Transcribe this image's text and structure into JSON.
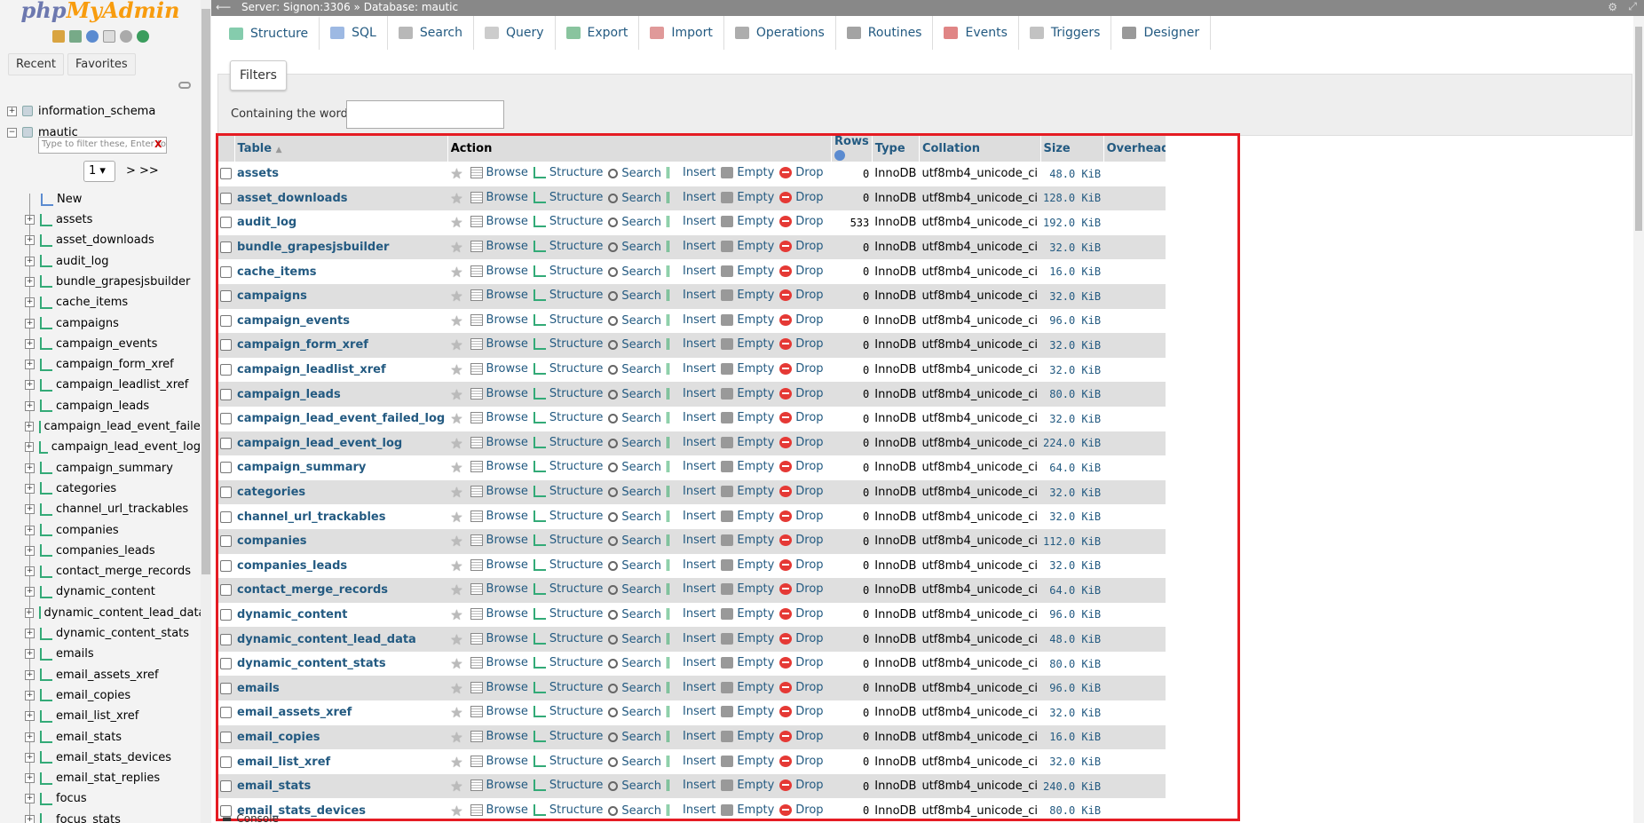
{
  "nav": {
    "logo_php": "php",
    "logo_myadmin": "MyAdmin",
    "tabs": [
      "Recent",
      "Favorites"
    ],
    "databases": [
      "information_schema",
      "mautic"
    ],
    "filter_placeholder": "Type to filter these, Enter to search",
    "filter_clear": "X",
    "page_value": "1",
    "page_next": "> >>",
    "new_label": "New",
    "tables": [
      "assets",
      "asset_downloads",
      "audit_log",
      "bundle_grapesjsbuilder",
      "cache_items",
      "campaigns",
      "campaign_events",
      "campaign_form_xref",
      "campaign_leadlist_xref",
      "campaign_leads",
      "campaign_lead_event_failed_log",
      "campaign_lead_event_log",
      "campaign_summary",
      "categories",
      "channel_url_trackables",
      "companies",
      "companies_leads",
      "contact_merge_records",
      "dynamic_content",
      "dynamic_content_lead_data",
      "dynamic_content_stats",
      "emails",
      "email_assets_xref",
      "email_copies",
      "email_list_xref",
      "email_stats",
      "email_stats_devices",
      "email_stat_replies",
      "focus",
      "focus_stats"
    ]
  },
  "topbar": {
    "server": "Server: Signon:3306",
    "sep": "»",
    "database": "Database: mautic"
  },
  "tabs": [
    "Structure",
    "SQL",
    "Search",
    "Query",
    "Export",
    "Import",
    "Operations",
    "Routines",
    "Events",
    "Triggers",
    "Designer"
  ],
  "filters": {
    "legend": "Filters",
    "label": "Containing the word:"
  },
  "table": {
    "headers": {
      "table": "Table",
      "action": "Action",
      "rows": "Rows",
      "type": "Type",
      "collation": "Collation",
      "size": "Size",
      "overhead": "Overhead"
    },
    "actions": [
      "Browse",
      "Structure",
      "Search",
      "Insert",
      "Empty",
      "Drop"
    ],
    "rows": [
      {
        "name": "assets",
        "rows": "0",
        "type": "InnoDB",
        "collation": "utf8mb4_unicode_ci",
        "size": "48.0 KiB",
        "overhead": "-"
      },
      {
        "name": "asset_downloads",
        "rows": "0",
        "type": "InnoDB",
        "collation": "utf8mb4_unicode_ci",
        "size": "128.0 KiB",
        "overhead": "-"
      },
      {
        "name": "audit_log",
        "rows": "533",
        "type": "InnoDB",
        "collation": "utf8mb4_unicode_ci",
        "size": "192.0 KiB",
        "overhead": "-"
      },
      {
        "name": "bundle_grapesjsbuilder",
        "rows": "0",
        "type": "InnoDB",
        "collation": "utf8mb4_unicode_ci",
        "size": "32.0 KiB",
        "overhead": "-"
      },
      {
        "name": "cache_items",
        "rows": "0",
        "type": "InnoDB",
        "collation": "utf8mb4_unicode_ci",
        "size": "16.0 KiB",
        "overhead": "-"
      },
      {
        "name": "campaigns",
        "rows": "0",
        "type": "InnoDB",
        "collation": "utf8mb4_unicode_ci",
        "size": "32.0 KiB",
        "overhead": "-"
      },
      {
        "name": "campaign_events",
        "rows": "0",
        "type": "InnoDB",
        "collation": "utf8mb4_unicode_ci",
        "size": "96.0 KiB",
        "overhead": "-"
      },
      {
        "name": "campaign_form_xref",
        "rows": "0",
        "type": "InnoDB",
        "collation": "utf8mb4_unicode_ci",
        "size": "32.0 KiB",
        "overhead": "-"
      },
      {
        "name": "campaign_leadlist_xref",
        "rows": "0",
        "type": "InnoDB",
        "collation": "utf8mb4_unicode_ci",
        "size": "32.0 KiB",
        "overhead": "-"
      },
      {
        "name": "campaign_leads",
        "rows": "0",
        "type": "InnoDB",
        "collation": "utf8mb4_unicode_ci",
        "size": "80.0 KiB",
        "overhead": "-"
      },
      {
        "name": "campaign_lead_event_failed_log",
        "rows": "0",
        "type": "InnoDB",
        "collation": "utf8mb4_unicode_ci",
        "size": "32.0 KiB",
        "overhead": "-"
      },
      {
        "name": "campaign_lead_event_log",
        "rows": "0",
        "type": "InnoDB",
        "collation": "utf8mb4_unicode_ci",
        "size": "224.0 KiB",
        "overhead": "-"
      },
      {
        "name": "campaign_summary",
        "rows": "0",
        "type": "InnoDB",
        "collation": "utf8mb4_unicode_ci",
        "size": "64.0 KiB",
        "overhead": "-"
      },
      {
        "name": "categories",
        "rows": "0",
        "type": "InnoDB",
        "collation": "utf8mb4_unicode_ci",
        "size": "32.0 KiB",
        "overhead": "-"
      },
      {
        "name": "channel_url_trackables",
        "rows": "0",
        "type": "InnoDB",
        "collation": "utf8mb4_unicode_ci",
        "size": "32.0 KiB",
        "overhead": "-"
      },
      {
        "name": "companies",
        "rows": "0",
        "type": "InnoDB",
        "collation": "utf8mb4_unicode_ci",
        "size": "112.0 KiB",
        "overhead": "-"
      },
      {
        "name": "companies_leads",
        "rows": "0",
        "type": "InnoDB",
        "collation": "utf8mb4_unicode_ci",
        "size": "32.0 KiB",
        "overhead": "-"
      },
      {
        "name": "contact_merge_records",
        "rows": "0",
        "type": "InnoDB",
        "collation": "utf8mb4_unicode_ci",
        "size": "64.0 KiB",
        "overhead": "-"
      },
      {
        "name": "dynamic_content",
        "rows": "0",
        "type": "InnoDB",
        "collation": "utf8mb4_unicode_ci",
        "size": "96.0 KiB",
        "overhead": "-"
      },
      {
        "name": "dynamic_content_lead_data",
        "rows": "0",
        "type": "InnoDB",
        "collation": "utf8mb4_unicode_ci",
        "size": "48.0 KiB",
        "overhead": "-"
      },
      {
        "name": "dynamic_content_stats",
        "rows": "0",
        "type": "InnoDB",
        "collation": "utf8mb4_unicode_ci",
        "size": "80.0 KiB",
        "overhead": "-"
      },
      {
        "name": "emails",
        "rows": "0",
        "type": "InnoDB",
        "collation": "utf8mb4_unicode_ci",
        "size": "96.0 KiB",
        "overhead": "-"
      },
      {
        "name": "email_assets_xref",
        "rows": "0",
        "type": "InnoDB",
        "collation": "utf8mb4_unicode_ci",
        "size": "32.0 KiB",
        "overhead": "-"
      },
      {
        "name": "email_copies",
        "rows": "0",
        "type": "InnoDB",
        "collation": "utf8mb4_unicode_ci",
        "size": "16.0 KiB",
        "overhead": "-"
      },
      {
        "name": "email_list_xref",
        "rows": "0",
        "type": "InnoDB",
        "collation": "utf8mb4_unicode_ci",
        "size": "32.0 KiB",
        "overhead": "-"
      },
      {
        "name": "email_stats",
        "rows": "0",
        "type": "InnoDB",
        "collation": "utf8mb4_unicode_ci",
        "size": "240.0 KiB",
        "overhead": "-"
      },
      {
        "name": "email_stats_devices",
        "rows": "0",
        "type": "InnoDB",
        "collation": "utf8mb4_unicode_ci",
        "size": "80.0 KiB",
        "overhead": "-"
      }
    ]
  },
  "console_label": "Console",
  "colors": {
    "link": "#235a81",
    "highlight": "#e51c23",
    "logo_php": "#6c78af",
    "logo_myadmin": "#f89c0e"
  }
}
